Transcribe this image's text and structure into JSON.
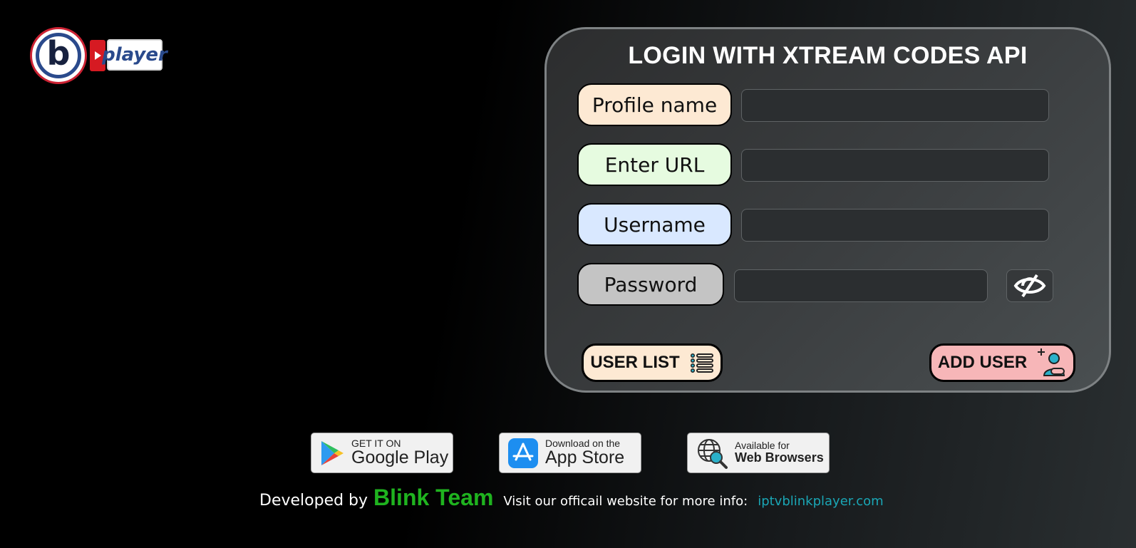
{
  "logo": {
    "letter": "b",
    "word": "player"
  },
  "form": {
    "title": "LOGIN WITH XTREAM CODES API",
    "fields": [
      {
        "label": "Profile name",
        "value": "",
        "color": "#fde9d3"
      },
      {
        "label": "Enter URL",
        "value": "",
        "color": "#e6fbe0"
      },
      {
        "label": "Username",
        "value": "",
        "color": "#d9e8ff"
      },
      {
        "label": "Password",
        "value": "",
        "color": "#c4c4c4"
      }
    ],
    "password_toggle_icon": "eye-slash-icon",
    "user_list_label": "USER LIST",
    "user_list_color": "#fde9d3",
    "add_user_label": "ADD USER",
    "add_user_color": "#f7b6b8"
  },
  "stores": {
    "google": {
      "small": "GET IT ON",
      "big": "Google Play"
    },
    "apple": {
      "small": "Download on the",
      "big": "App Store"
    },
    "web": {
      "small": "Available for",
      "big": "Web Browsers"
    }
  },
  "footer": {
    "developed_by": "Developed by",
    "team": "Blink Team",
    "visit_text": "Visit our officail website for more info:",
    "website": "iptvblinkplayer.com"
  }
}
